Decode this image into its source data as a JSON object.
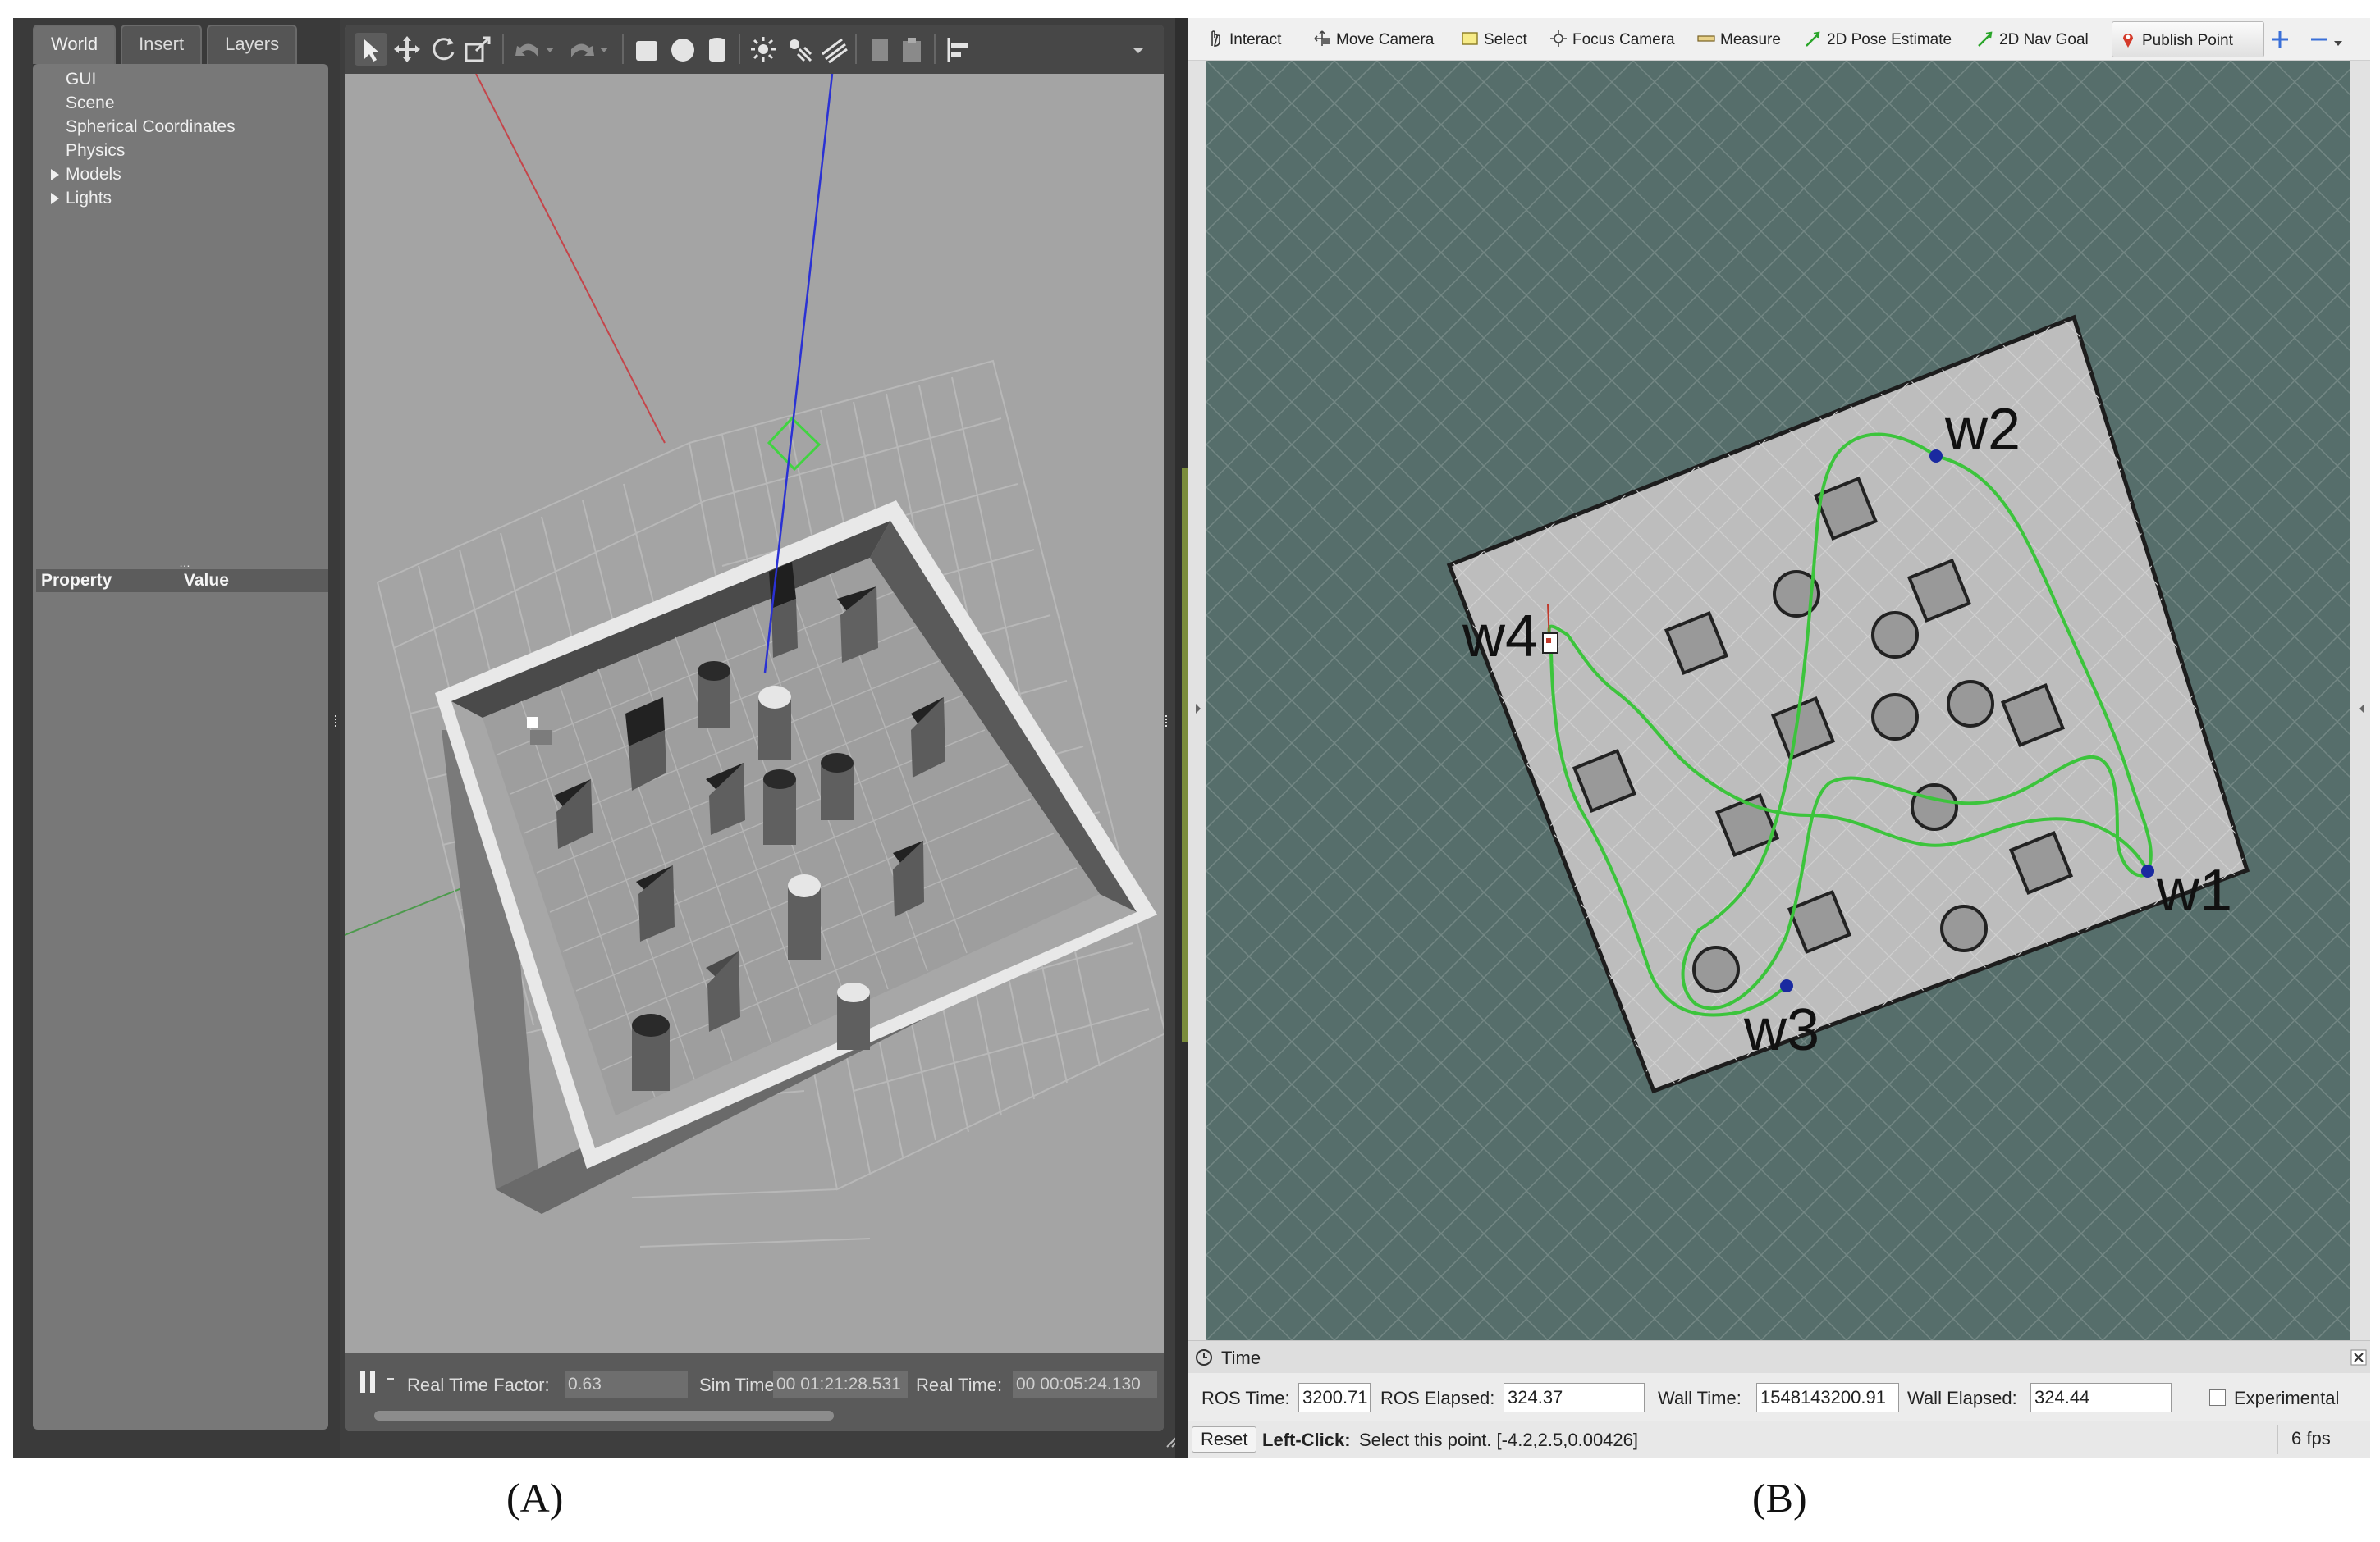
{
  "gazebo": {
    "tabs": [
      "World",
      "Insert",
      "Layers"
    ],
    "world_tree": [
      {
        "label": "GUI",
        "expandable": false
      },
      {
        "label": "Scene",
        "expandable": false
      },
      {
        "label": "Spherical Coordinates",
        "expandable": false
      },
      {
        "label": "Physics",
        "expandable": false
      },
      {
        "label": "Models",
        "expandable": true
      },
      {
        "label": "Lights",
        "expandable": true
      }
    ],
    "property_header": {
      "property": "Property",
      "value": "Value"
    },
    "toolbar_icons": [
      "select-arrow-icon",
      "translate-icon",
      "rotate-icon",
      "scale-icon",
      "undo-icon",
      "undo-dropdown-icon",
      "redo-icon",
      "redo-dropdown-icon",
      "box-shape-icon",
      "sphere-shape-icon",
      "cylinder-shape-icon",
      "point-light-icon",
      "spot-light-icon",
      "directional-light-icon",
      "copy-icon",
      "paste-icon",
      "align-icon",
      "toolbar-overflow-icon"
    ],
    "status": {
      "real_time_factor_label": "Real Time Factor:",
      "real_time_factor": "0.63",
      "sim_time_label": "Sim Time:",
      "sim_time": "00 01:21:28.531",
      "real_time_label": "Real Time:",
      "real_time": "00 00:05:24.130"
    }
  },
  "rviz": {
    "toolbar": [
      {
        "label": "Interact",
        "icon": "interact-hand-icon"
      },
      {
        "label": "Move Camera",
        "icon": "move-camera-icon"
      },
      {
        "label": "Select",
        "icon": "select-box-icon"
      },
      {
        "label": "Focus Camera",
        "icon": "focus-camera-icon"
      },
      {
        "label": "Measure",
        "icon": "measure-ruler-icon"
      },
      {
        "label": "2D Pose Estimate",
        "icon": "pose-estimate-arrow-icon"
      },
      {
        "label": "2D Nav Goal",
        "icon": "nav-goal-arrow-icon"
      },
      {
        "label": "Publish Point",
        "icon": "publish-point-pin-icon"
      }
    ],
    "toolbar_extra_icons": [
      "add-tool-plus-icon",
      "remove-tool-minus-icon"
    ],
    "waypoints": [
      "w1",
      "w2",
      "w3",
      "w4"
    ],
    "time_panel": {
      "title": "Time",
      "ros_time_label": "ROS Time:",
      "ros_time": "3200.71",
      "ros_elapsed_label": "ROS Elapsed:",
      "ros_elapsed": "324.37",
      "wall_time_label": "Wall Time:",
      "wall_time": "1548143200.91",
      "wall_elapsed_label": "Wall Elapsed:",
      "wall_elapsed": "324.44",
      "experimental_label": "Experimental"
    },
    "status_bar": {
      "reset_label": "Reset",
      "hint_bold": "Left-Click:",
      "hint_text": "Select this point. [-4.2,2.5,0.00426]",
      "fps": "6 fps"
    },
    "colors": {
      "path": "#3cc43c",
      "waypoint": "#1a2aa0",
      "grid_bg": "#566e6b"
    }
  },
  "captions": {
    "a": "(A)",
    "b": "(B)"
  }
}
